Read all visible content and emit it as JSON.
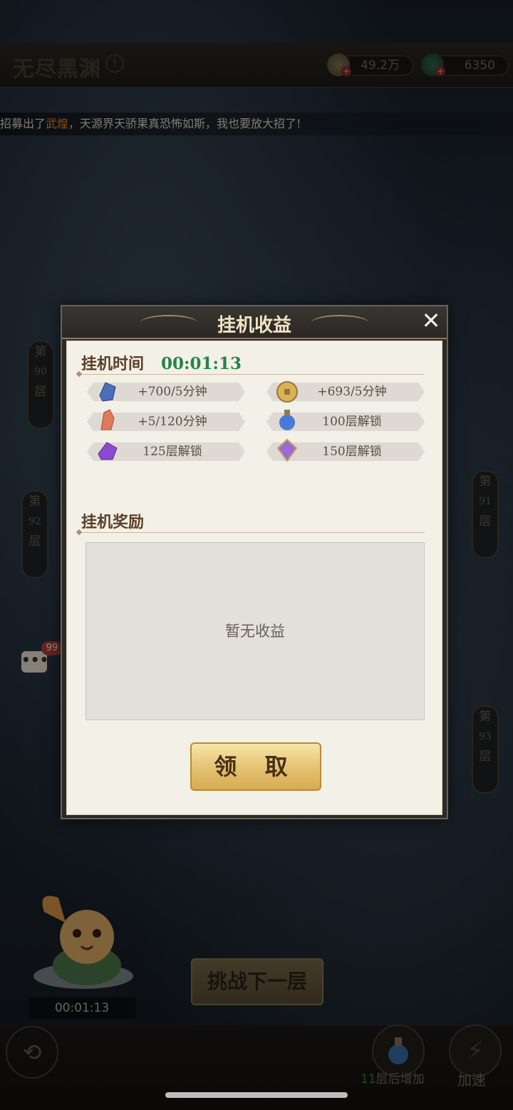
{
  "header": {
    "title": "无尽黑渊",
    "info_icon": "!",
    "resources": [
      {
        "name": "coin-icon",
        "value": "49.2万",
        "plus": "+"
      },
      {
        "name": "jade-icon",
        "value": "6350",
        "plus": "+"
      }
    ]
  },
  "ticker": {
    "prefix": "招募出了",
    "highlight": "武煌",
    "suffix": "，天源界天骄果真恐怖如斯，我也要放大招了!"
  },
  "floors": [
    {
      "di": "第",
      "num": "90",
      "ceng": "层"
    },
    {
      "di": "第",
      "num": "92",
      "ceng": "层"
    },
    {
      "di": "第",
      "num": "91",
      "ceng": "层"
    },
    {
      "di": "第",
      "num": "93",
      "ceng": "层"
    }
  ],
  "chat": {
    "icon": "•••",
    "badge": "99"
  },
  "idle_timer": "00:01:13",
  "next_floor_button": "挑战下一层",
  "bottom": {
    "back_icon": "⟲",
    "potion_prefix": "11",
    "potion_suffix": "层后增加",
    "speed_icon": "⚡",
    "speed_label": "加速"
  },
  "dialog": {
    "title": "挂机收益",
    "close_icon": "✕",
    "time_label": "挂机时间",
    "time_value": "00:01:13",
    "earnings": [
      {
        "icon": "blue-crystal-icon",
        "text": "+700/5分钟"
      },
      {
        "icon": "gold-coin-icon",
        "text": "+693/5分钟"
      },
      {
        "icon": "red-crystal-icon",
        "text": "+5/120分钟"
      },
      {
        "icon": "blue-potion-icon",
        "text": "100层解锁"
      },
      {
        "icon": "purple-crystal-icon",
        "text": "125层解锁"
      },
      {
        "icon": "purple-gem-icon",
        "text": "150层解锁"
      }
    ],
    "reward_label": "挂机奖励",
    "empty_text": "暂无收益",
    "claim_button": "领 取"
  },
  "colors": {
    "accent_green": "#26834a",
    "highlight_orange": "#ff8a2a",
    "gold": "#e3c170"
  }
}
